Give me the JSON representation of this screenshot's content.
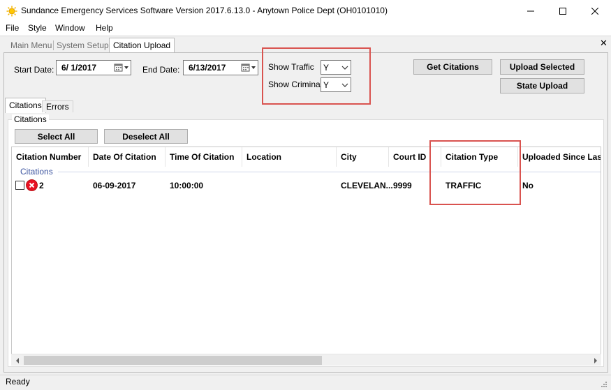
{
  "window": {
    "title": "Sundance Emergency Services Software Version 2017.6.13.0 - Anytown Police Dept (OH0101010)",
    "app_icon": "sun-icon"
  },
  "menu": [
    "File",
    "Style",
    "Window",
    "Help"
  ],
  "doc_tabs": [
    {
      "label": "Main Menu",
      "active": false
    },
    {
      "label": "System Setup",
      "active": false
    },
    {
      "label": "Citation Upload",
      "active": true
    }
  ],
  "filters": {
    "start_date_label": "Start Date:",
    "start_date": "6/  1/2017",
    "end_date_label": "End Date:",
    "end_date": "6/13/2017",
    "show_traffic_label": "Show Traffic",
    "show_traffic": "Y",
    "show_criminal_label": "Show Criminal",
    "show_criminal": "Y"
  },
  "buttons": {
    "get_citations": "Get Citations",
    "upload_selected": "Upload Selected",
    "state_upload": "State Upload",
    "select_all": "Select All",
    "deselect_all": "Deselect All"
  },
  "inner_tabs": [
    {
      "label": "Citations",
      "active": true
    },
    {
      "label": "Errors",
      "active": false
    }
  ],
  "group_label": "Citations",
  "grid": {
    "columns": [
      "Citation Number",
      "Date Of Citation",
      "Time Of Citation",
      "Location",
      "City",
      "Court ID",
      "Citation Type",
      "Uploaded Since Last"
    ],
    "group_header": "Citations",
    "rows": [
      {
        "checked": false,
        "status_icon": "error-icon",
        "citation_number": "2",
        "date": "06-09-2017",
        "time": "10:00:00",
        "location": "",
        "city": "CLEVELAN...",
        "court_id": "9999",
        "citation_type": "TRAFFIC",
        "uploaded": "No"
      }
    ]
  },
  "status": "Ready",
  "colors": {
    "highlight": "#d9534f",
    "group_header": "#3d55a0",
    "error_red": "#e81123"
  }
}
